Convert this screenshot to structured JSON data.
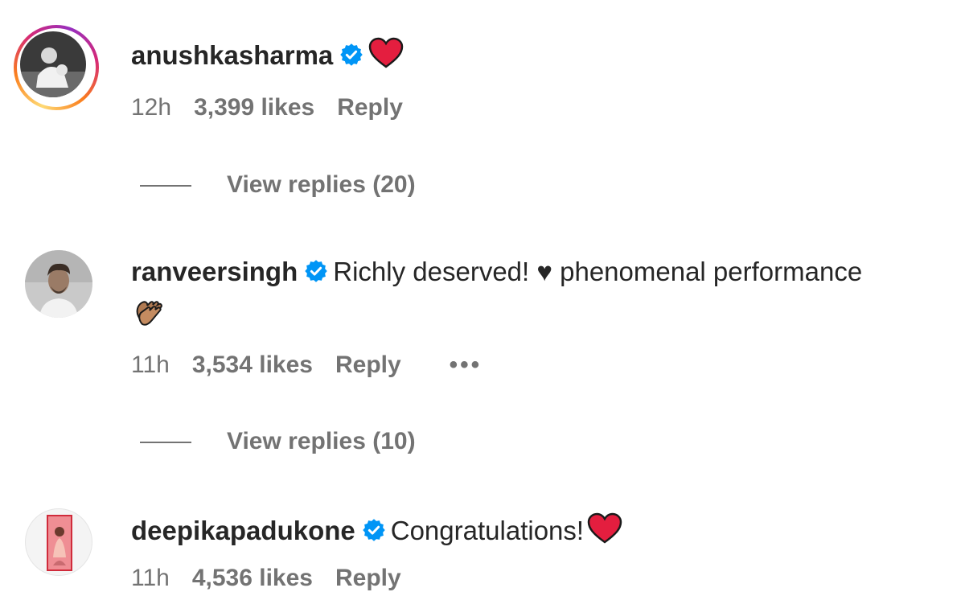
{
  "comments": [
    {
      "username": "anushkasharma",
      "text": "",
      "emoji": "red-heart",
      "time": "12h",
      "likes": "3,399 likes",
      "reply": "Reply",
      "view_replies": "View replies (20)"
    },
    {
      "username": "ranveersingh",
      "text": "Richly deserved! ♥ phenomenal performance",
      "emoji": "clapping-hands",
      "time": "11h",
      "likes": "3,534 likes",
      "reply": "Reply",
      "more": "•••",
      "view_replies": "View replies (10)"
    },
    {
      "username": "deepikapadukone",
      "text": "Congratulations!",
      "emoji": "red-heart",
      "time": "11h",
      "likes": "4,536 likes",
      "reply": "Reply"
    }
  ],
  "colors": {
    "verified": "#0095f6",
    "heart": "#e41e3f",
    "secondary": "#737373"
  }
}
